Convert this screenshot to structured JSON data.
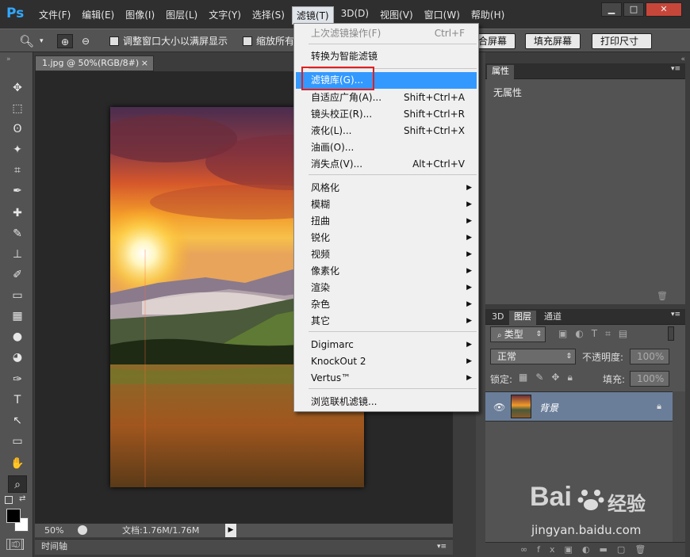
{
  "app": {
    "logo": "Ps"
  },
  "menubar": {
    "items": [
      "文件(F)",
      "编辑(E)",
      "图像(I)",
      "图层(L)",
      "文字(Y)",
      "选择(S)",
      "滤镜(T)",
      "3D(D)",
      "视图(V)",
      "窗口(W)",
      "帮助(H)"
    ],
    "active": "滤镜(T)"
  },
  "window_controls": {
    "minimize": "▁",
    "maximize": "□",
    "close": "✕"
  },
  "options_bar": {
    "resize_window": "调整窗口大小以满屏显示",
    "zoom_all": "缩放所有",
    "fit_screen": "合屏幕",
    "fill_screen": "填充屏幕",
    "print_size": "打印尺寸"
  },
  "document": {
    "tab_title": "1.jpg @ 50%(RGB/8#)",
    "close": "×"
  },
  "status": {
    "zoom": "50%",
    "doc_info": "文档:1.76M/1.76M"
  },
  "timeline": {
    "label": "时间轴"
  },
  "properties_panel": {
    "tab": "属性",
    "content": "无属性"
  },
  "layers_panel": {
    "tabs": [
      "3D",
      "图层",
      "通道"
    ],
    "active_tab": "图层",
    "filter_kind": "类型",
    "blend_mode": "正常",
    "opacity_label": "不透明度:",
    "opacity_value": "100%",
    "lock_label": "锁定:",
    "fill_label": "填充:",
    "fill_value": "100%",
    "layers": [
      {
        "name": "背景",
        "locked": true,
        "visible": true
      }
    ]
  },
  "filter_menu": {
    "items": [
      {
        "label": "上次滤镜操作(F)",
        "shortcut": "Ctrl+F",
        "disabled": true
      },
      {
        "label": "转换为智能滤镜"
      },
      {
        "label": "滤镜库(G)...",
        "highlighted": true
      },
      {
        "label": "自适应广角(A)...",
        "shortcut": "Shift+Ctrl+A"
      },
      {
        "label": "镜头校正(R)...",
        "shortcut": "Shift+Ctrl+R"
      },
      {
        "label": "液化(L)...",
        "shortcut": "Shift+Ctrl+X"
      },
      {
        "label": "油画(O)..."
      },
      {
        "label": "消失点(V)...",
        "shortcut": "Alt+Ctrl+V"
      },
      {
        "label": "风格化",
        "submenu": true
      },
      {
        "label": "模糊",
        "submenu": true
      },
      {
        "label": "扭曲",
        "submenu": true
      },
      {
        "label": "锐化",
        "submenu": true
      },
      {
        "label": "视频",
        "submenu": true
      },
      {
        "label": "像素化",
        "submenu": true
      },
      {
        "label": "渲染",
        "submenu": true
      },
      {
        "label": "杂色",
        "submenu": true
      },
      {
        "label": "其它",
        "submenu": true
      },
      {
        "label": "Digimarc",
        "submenu": true
      },
      {
        "label": "KnockOut 2",
        "submenu": true
      },
      {
        "label": "Vertus™",
        "submenu": true
      },
      {
        "label": "浏览联机滤镜..."
      }
    ]
  },
  "watermark": {
    "brand_left": "Bai",
    "brand_right": "经验",
    "url": "jingyan.baidu.com"
  },
  "colors": {
    "highlight": "#3399ff",
    "annotation_box": "#e02020",
    "layer_selected": "#6a7e99",
    "ps_blue": "#31a8ff"
  },
  "icons": {
    "tools": [
      "move-icon",
      "marquee-icon",
      "lasso-icon",
      "magic-wand-icon",
      "crop-icon",
      "eyedropper-icon",
      "healing-brush-icon",
      "brush-icon",
      "stamp-icon",
      "history-brush-icon",
      "eraser-icon",
      "gradient-icon",
      "blur-icon",
      "dodge-icon",
      "pen-icon",
      "type-icon",
      "path-selection-icon",
      "shape-icon",
      "hand-icon",
      "zoom-icon"
    ]
  }
}
